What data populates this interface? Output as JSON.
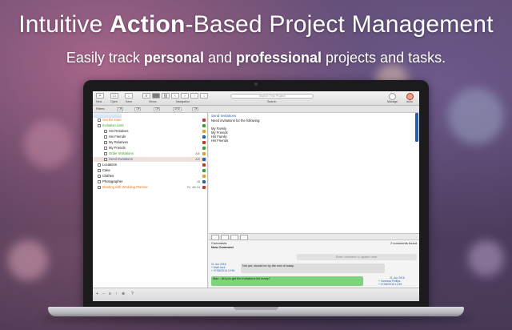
{
  "hero": {
    "title_pre": "Intuitive ",
    "title_bold": "Action",
    "title_post": "-Based Project Management",
    "sub_1": "Easily track ",
    "sub_bold_1": "personal",
    "sub_2": " and ",
    "sub_bold_2": "professional",
    "sub_3": " projects and tasks."
  },
  "toolbar": {
    "new_label": "New",
    "open_label": "Open",
    "save_label": "Save",
    "views_label": "Views",
    "navigation_label": "Navigation",
    "search_placeholder": "Search This Project",
    "search_label": "Search",
    "manage_label": "Manage",
    "actions_label": "Actio"
  },
  "filterbar": {
    "label": "Filters:",
    "chips": [
      "Off",
      "Off",
      "Off",
      "AND",
      "Off"
    ]
  },
  "tree": {
    "rows": [
      {
        "label": "Get the Date",
        "color": "#e07a1f",
        "indent": 0,
        "meta": ""
      },
      {
        "label": "Invitation Lists",
        "color": "#3aa02a",
        "indent": 0,
        "meta": ""
      },
      {
        "label": "His Relatives",
        "color": "#222222",
        "indent": 1,
        "meta": ""
      },
      {
        "label": "His Friends",
        "color": "#222222",
        "indent": 1,
        "meta": ""
      },
      {
        "label": "My Relatives",
        "color": "#222222",
        "indent": 1,
        "meta": ""
      },
      {
        "label": "My Friends",
        "color": "#222222",
        "indent": 1,
        "meta": ""
      },
      {
        "label": "Order Invitations",
        "color": "#3aa02a",
        "indent": 1,
        "meta": "A/E"
      },
      {
        "label": "Send Invitations",
        "color": "#2a5fb0",
        "indent": 1,
        "meta": "A/E"
      },
      {
        "label": "Locations",
        "color": "#111111",
        "indent": 0,
        "meta": ""
      },
      {
        "label": "Cake",
        "color": "#111111",
        "indent": 0,
        "meta": ""
      },
      {
        "label": "Clothes",
        "color": "#111111",
        "indent": 0,
        "meta": ""
      },
      {
        "label": "Photographer",
        "color": "#111111",
        "indent": 0,
        "meta": "JB"
      },
      {
        "label": "Meeting with Wedding Planner",
        "color": "#e07a1f",
        "indent": 0,
        "meta": "Fri, 4th 24"
      }
    ]
  },
  "detail": {
    "title": "Send Invitations",
    "body": "Need invitations for the following:\n\nMy Family\nMy Friends\nHis Family\nHis Friends"
  },
  "comments": {
    "header": "Comments",
    "new_comment": "New Comment",
    "count": "2 comments found",
    "input_placeholder": "Enter comment or update here.",
    "c1_date": "21 Jun 2016",
    "c1_author": "+ Matt Jack",
    "c1_time": "+ 07/06/2016 12:56",
    "c1_text": "Not yet, should be by the end of today.",
    "c2_date": "21 Jun 2016",
    "c2_author": "+ Vanessa Phillips",
    "c2_time": "+ 07/06/2016 12:49",
    "c2_text": "Max - did you get the invitations list ready?"
  },
  "bottombar": {
    "items": [
      "+",
      "−",
      "≡",
      "↑",
      "⊕",
      "?"
    ]
  }
}
